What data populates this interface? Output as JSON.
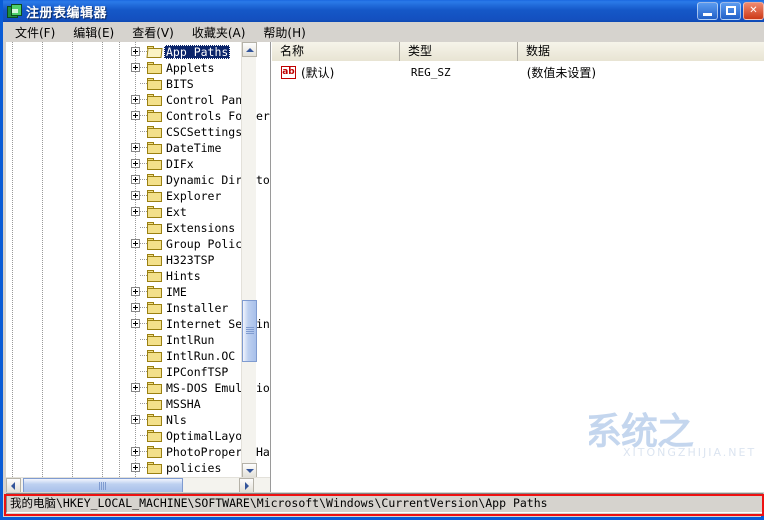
{
  "window": {
    "title": "注册表编辑器",
    "icon": "registry-editor-icon"
  },
  "window_controls": {
    "minimize": "最小化",
    "maximize": "最大化",
    "close": "关闭"
  },
  "menu": {
    "items": [
      {
        "label": "文件(F)"
      },
      {
        "label": "编辑(E)"
      },
      {
        "label": "查看(V)"
      },
      {
        "label": "收藏夹(A)"
      },
      {
        "label": "帮助(H)"
      }
    ]
  },
  "tree": {
    "items": [
      {
        "label": "App Paths",
        "expandable": true,
        "selected": true
      },
      {
        "label": "Applets",
        "expandable": true,
        "selected": false
      },
      {
        "label": "BITS",
        "expandable": false,
        "selected": false
      },
      {
        "label": "Control Panel",
        "expandable": true,
        "selected": false
      },
      {
        "label": "Controls Folder",
        "expandable": true,
        "selected": false
      },
      {
        "label": "CSCSettings",
        "expandable": false,
        "selected": false
      },
      {
        "label": "DateTime",
        "expandable": true,
        "selected": false
      },
      {
        "label": "DIFx",
        "expandable": true,
        "selected": false
      },
      {
        "label": "Dynamic Directo",
        "expandable": true,
        "selected": false
      },
      {
        "label": "Explorer",
        "expandable": true,
        "selected": false
      },
      {
        "label": "Ext",
        "expandable": true,
        "selected": false
      },
      {
        "label": "Extensions",
        "expandable": false,
        "selected": false
      },
      {
        "label": "Group Policy",
        "expandable": true,
        "selected": false
      },
      {
        "label": "H323TSP",
        "expandable": false,
        "selected": false
      },
      {
        "label": "Hints",
        "expandable": false,
        "selected": false
      },
      {
        "label": "IME",
        "expandable": true,
        "selected": false
      },
      {
        "label": "Installer",
        "expandable": true,
        "selected": false
      },
      {
        "label": "Internet Settin",
        "expandable": true,
        "selected": false
      },
      {
        "label": "IntlRun",
        "expandable": false,
        "selected": false
      },
      {
        "label": "IntlRun.OC",
        "expandable": false,
        "selected": false
      },
      {
        "label": "IPConfTSP",
        "expandable": false,
        "selected": false
      },
      {
        "label": "MS-DOS Emulatio",
        "expandable": true,
        "selected": false
      },
      {
        "label": "MSSHA",
        "expandable": false,
        "selected": false
      },
      {
        "label": "Nls",
        "expandable": true,
        "selected": false
      },
      {
        "label": "OptimalLayout",
        "expandable": false,
        "selected": false
      },
      {
        "label": "PhotoPropertyHa",
        "expandable": true,
        "selected": false
      },
      {
        "label": "policies",
        "expandable": true,
        "selected": false
      }
    ]
  },
  "list": {
    "columns": [
      "名称",
      "类型",
      "数据"
    ],
    "rows": [
      {
        "name": "(默认)",
        "type": "REG_SZ",
        "data": "(数值未设置)",
        "icon": "string-value-icon"
      }
    ]
  },
  "status": {
    "path": "我的电脑\\HKEY_LOCAL_MACHINE\\SOFTWARE\\Microsoft\\Windows\\CurrentVersion\\App Paths"
  },
  "watermark": {
    "text": "系统之",
    "subtext": "XITONGZHIJIA.NET"
  },
  "colors": {
    "titlebar": "#1558c8",
    "selection": "#0a246a",
    "highlight_box": "#ee1111",
    "face": "#d6d3ce",
    "header": "#ece9d8"
  }
}
